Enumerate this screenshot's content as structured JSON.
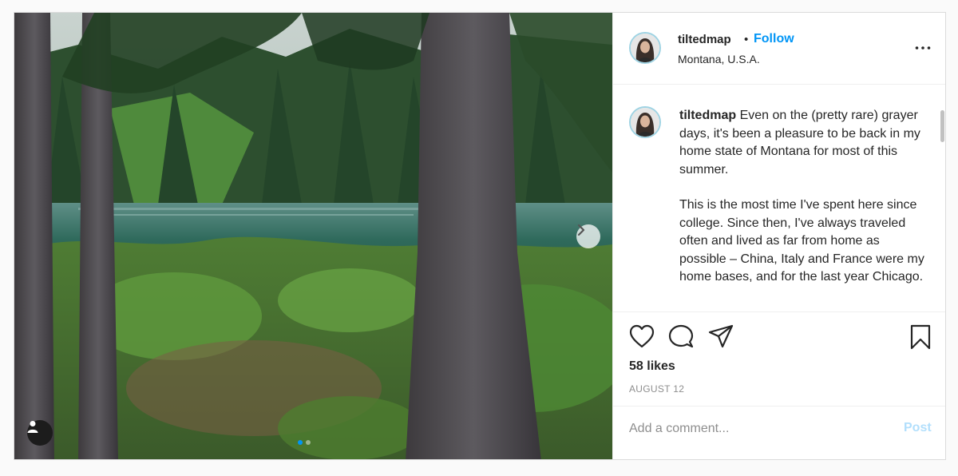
{
  "post": {
    "username": "tiltedmap",
    "separator": "•",
    "follow_label": "Follow",
    "location": "Montana, U.S.A.",
    "caption_paragraphs": [
      "Even on the (pretty rare) grayer days, it's been a pleasure to be back in my home state of Montana for most of this summer.",
      "This is the most time I've spent here since college. Since then, I've always traveled often and lived as far from home as possible – China, Italy and France were my home bases, and for the last year Chicago."
    ],
    "likes": "58 likes",
    "date": "AUGUST 12",
    "comment_placeholder": "Add a comment...",
    "post_label": "Post",
    "carousel_total": 2,
    "carousel_current": 1
  },
  "colors": {
    "accent": "#0095f6",
    "post_disabled": "#b2dffc",
    "muted": "#8e8e8e",
    "avatar_ring": "#9fd3e3"
  },
  "icons": [
    "chevron-right-icon",
    "user-tag-icon",
    "more-options-icon",
    "heart-icon",
    "comment-icon",
    "share-icon",
    "bookmark-icon"
  ]
}
